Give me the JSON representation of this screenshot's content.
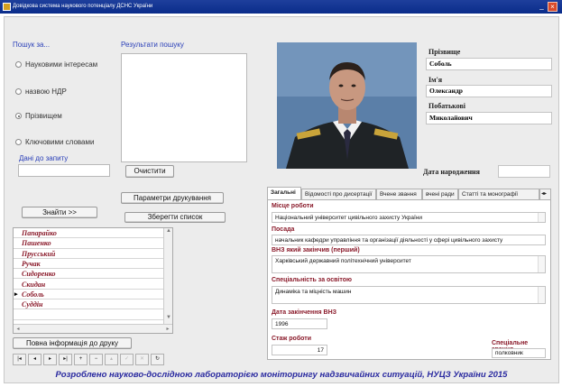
{
  "window": {
    "title": "Довідкова система наукового потенціалу ДСНС України",
    "minimize": "_",
    "close": "×"
  },
  "search": {
    "heading": "Пошук за...",
    "options": [
      {
        "label": "Науковими інтересам",
        "selected": false
      },
      {
        "label": "назвою НДР",
        "selected": false
      },
      {
        "label": "Прізвищем",
        "selected": true
      },
      {
        "label": "Ключовими словами",
        "selected": false
      }
    ],
    "query_label": "Дані до запиту",
    "query_value": "",
    "find_button": "Знайти >>"
  },
  "results": {
    "heading": "Результати пошуку",
    "clear_button": "Очистити",
    "print_params_button": "Параметри друкування",
    "save_list_button": "Зберегти список",
    "items": [
      {
        "name": "Папарайко",
        "current": false
      },
      {
        "name": "Пашенко",
        "current": false
      },
      {
        "name": "Прусський",
        "current": false
      },
      {
        "name": "Ручак",
        "current": false
      },
      {
        "name": "Сидоренко",
        "current": false
      },
      {
        "name": "Скидан",
        "current": false
      },
      {
        "name": "Соболь",
        "current": true
      },
      {
        "name": "Суддін",
        "current": false
      }
    ],
    "full_print_button": "Повна інформація до друку"
  },
  "navigator": {
    "buttons": [
      {
        "icon": "first-record-icon",
        "glyph": "|◂"
      },
      {
        "icon": "prior-record-icon",
        "glyph": "◂"
      },
      {
        "icon": "next-record-icon",
        "glyph": "▸"
      },
      {
        "icon": "last-record-icon",
        "glyph": "▸|"
      },
      {
        "icon": "insert-record-icon",
        "glyph": "+"
      },
      {
        "icon": "delete-record-icon",
        "glyph": "−"
      },
      {
        "icon": "edit-record-icon",
        "glyph": "▴"
      },
      {
        "icon": "post-record-icon",
        "glyph": "✓"
      },
      {
        "icon": "cancel-record-icon",
        "glyph": "✕"
      },
      {
        "icon": "refresh-icon",
        "glyph": "↻"
      }
    ]
  },
  "person": {
    "surname_label": "Прізвище",
    "surname": "Соболь",
    "name_label": "Ім'я",
    "name": "Олександр",
    "patronymic_label": "Побатькові",
    "patronymic": "Миколайович",
    "birthdate_label": "Дата народження",
    "birthdate": ""
  },
  "tabs": [
    {
      "label": "Загальні",
      "active": true
    },
    {
      "label": "Відомості про дисертації",
      "active": false
    },
    {
      "label": "Вчене звання",
      "active": false
    },
    {
      "label": "вчені ради",
      "active": false
    },
    {
      "label": "Статті та монографії",
      "active": false
    }
  ],
  "general": {
    "workplace_label": "Місце роботи",
    "workplace": "Національний університет цивільного захисту України",
    "position_label": "Посада",
    "position": "начальник кафедри управління та організації діяльності у сфері цивільного захисту",
    "university_label": "ВНЗ який закінчив (перший)",
    "university": "Харківський державний політехнічний університет",
    "specialty_label": "Спеціальність за освітою",
    "specialty": "Динаміка та міцність машин",
    "grad_date_label": "Дата закінчення ВНЗ",
    "grad_date": "1996",
    "experience_label": "Стаж роботи",
    "experience": "17",
    "special_rank_label": "Спеціальне звання",
    "special_rank": "полковник"
  },
  "footer": {
    "text": "Розроблено науково-дослідною лабораторією моніторингу надзвичайних ситуацій, НУЦЗ України 2015"
  },
  "colors": {
    "title_bar": "#0a2c8a",
    "accent_blue": "#2a3fb8",
    "label_red": "#8a1a2a",
    "footer_blue": "#2a2aa0"
  }
}
